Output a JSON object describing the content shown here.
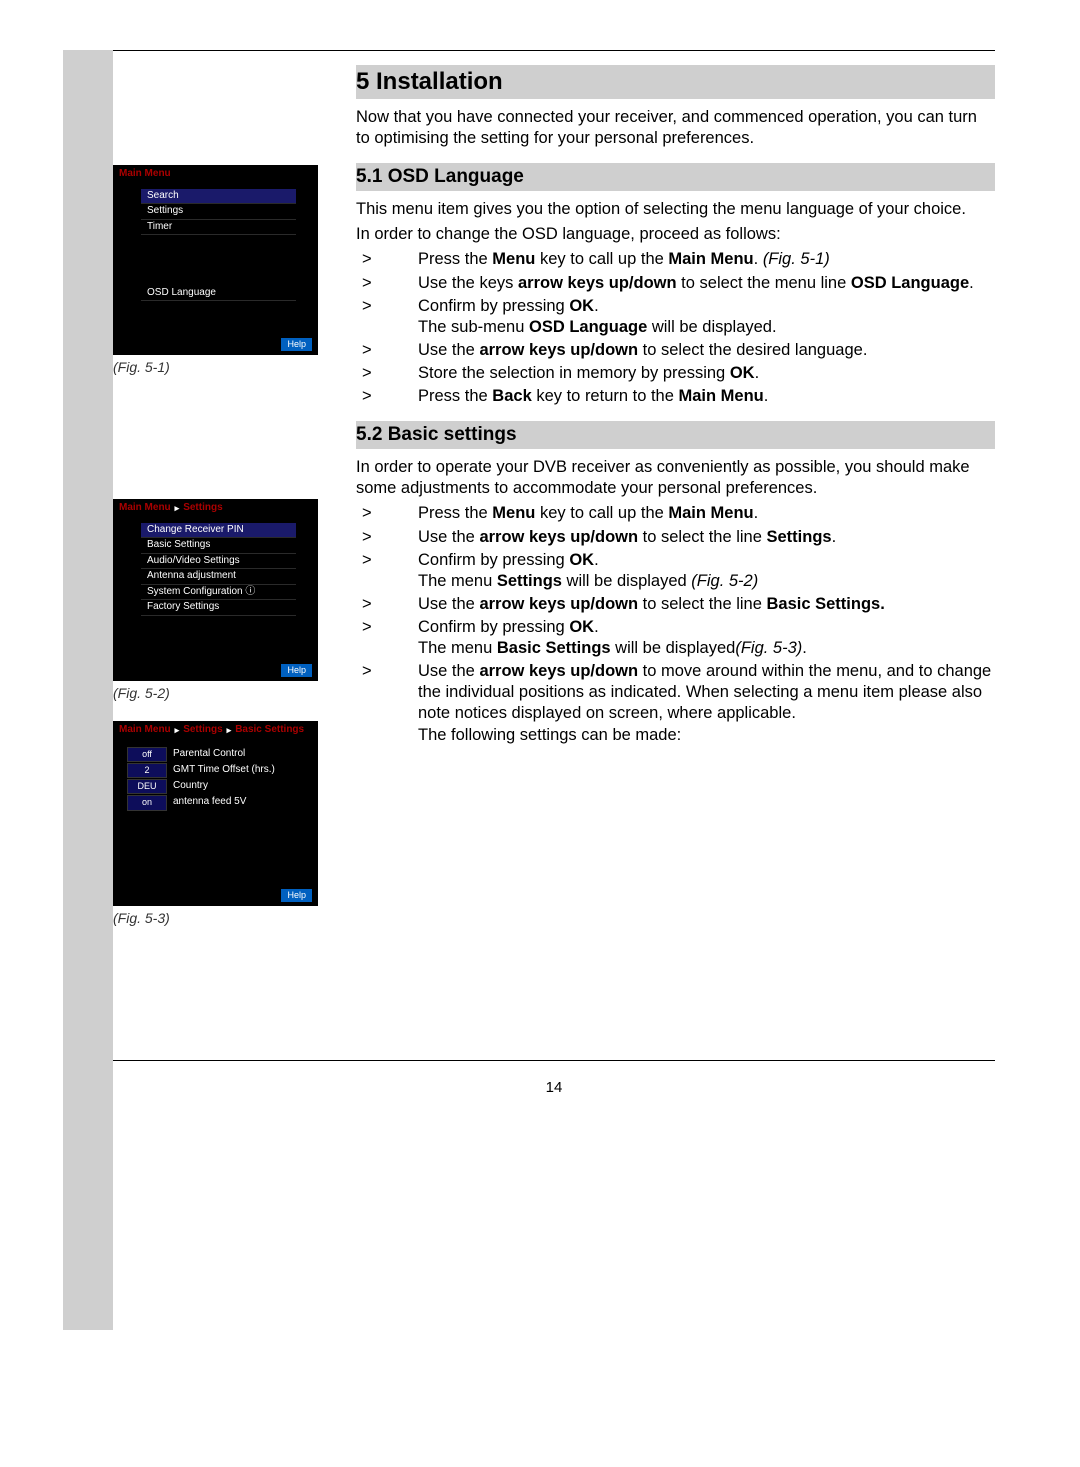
{
  "page_number": "14",
  "section_title": "5 Installation",
  "intro": "Now that you have connected your receiver, and commenced operation, you can turn to optimising the setting for your personal preferences.",
  "sec51": {
    "heading": "5.1 OSD Language",
    "p1": "This menu item gives you the option of selecting the menu language of your choice.",
    "p2": "In order to change the OSD language, proceed as follows:",
    "steps": [
      {
        "pre": "Press the ",
        "b1": "Menu",
        "mid": " key to call up the ",
        "b2": "Main Menu",
        "post": ". ",
        "ital": "(Fig. 5-1)"
      },
      {
        "pre": "Use the keys ",
        "b1": "arrow keys up/down",
        "mid": " to select the menu line ",
        "b2": "OSD Language",
        "post": "."
      },
      {
        "pre": "Confirm by pressing ",
        "b1": "OK",
        "post": ".",
        "tail": "The sub-menu ",
        "tb1": "OSD Language",
        "tail2": " will be displayed."
      },
      {
        "pre": "Use the ",
        "b1": "arrow keys up/down",
        "mid": " to select the desired language."
      },
      {
        "pre": "Store the selection in memory by pressing ",
        "b1": "OK",
        "post": "."
      },
      {
        "pre": "Press the ",
        "b1": "Back",
        "mid": " key to return to the ",
        "b2": "Main Menu",
        "post": "."
      }
    ]
  },
  "sec52": {
    "heading": "5.2 Basic settings",
    "p1": "In order to operate your DVB receiver as conveniently as possible, you should make some adjustments to accommodate your personal preferences.",
    "steps": [
      {
        "pre": "Press the ",
        "b1": "Menu",
        "mid": " key to call up the ",
        "b2": "Main Menu",
        "post": "."
      },
      {
        "pre": "Use the ",
        "b1": "arrow keys up/down",
        "mid": " to select the line ",
        "b2": "Settings",
        "post": "."
      },
      {
        "pre": "Confirm by pressing ",
        "b1": "OK",
        "post": ".",
        "tail": "The menu ",
        "tb1": "Settings",
        "tail2": " will be displayed ",
        "ital": "(Fig. 5-2)"
      },
      {
        "pre": "Use the ",
        "b1": "arrow keys up/down",
        "mid": " to select the line ",
        "b2": "Basic Settings.",
        "post": ""
      },
      {
        "pre": "Confirm by pressing ",
        "b1": "OK",
        "post": ".",
        "tail": "The menu ",
        "tb1": "Basic Settings",
        "tail2": " will be displayed",
        "ital": "(Fig. 5-3)",
        "tail3": "."
      },
      {
        "pre": "Use the ",
        "b1": "arrow keys up/down",
        "mid": " to move around within the menu,  and to change the individual positions as indicated. When selecting a menu item please also note notices displayed on screen, where applicable.",
        "tail": "The following settings can be made:"
      }
    ]
  },
  "fig1": {
    "caption": "(Fig. 5-1)",
    "breadcrumb": "Main Menu",
    "items": [
      "Search",
      "Settings",
      "Timer"
    ],
    "osd": "OSD Language",
    "help": "Help"
  },
  "fig2": {
    "caption": "(Fig. 5-2)",
    "breadcrumb": [
      "Main Menu",
      "Settings"
    ],
    "items": [
      "Change Receiver PIN",
      "Basic Settings",
      "Audio/Video Settings",
      "Antenna adjustment",
      "System Configuration ⓘ",
      "Factory Settings"
    ],
    "help": "Help"
  },
  "fig3": {
    "caption": "(Fig. 5-3)",
    "breadcrumb": [
      "Main Menu",
      "Settings",
      "Basic Settings"
    ],
    "rows": [
      {
        "val": "off",
        "label": "Parental Control"
      },
      {
        "val": "2",
        "label": "GMT Time Offset (hrs.)"
      },
      {
        "val": "DEU",
        "label": "Country"
      },
      {
        "val": "on",
        "label": "antenna feed 5V"
      }
    ],
    "help": "Help"
  }
}
